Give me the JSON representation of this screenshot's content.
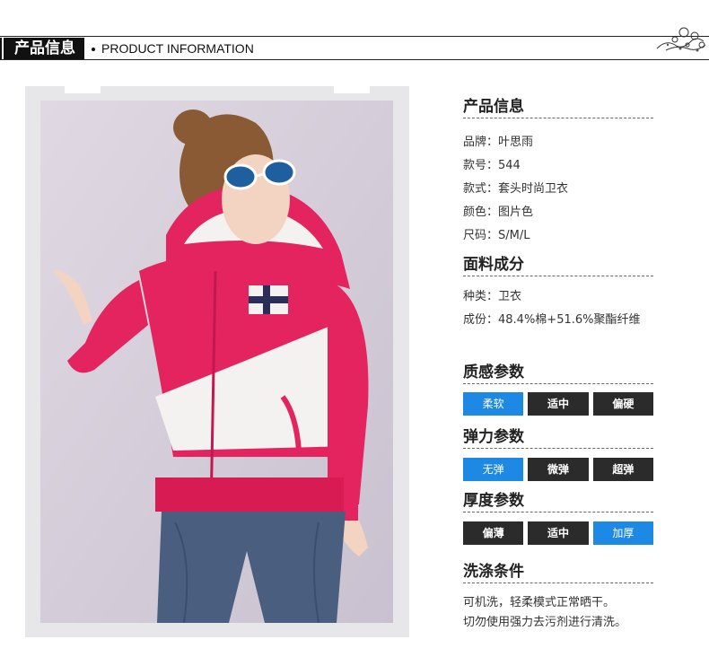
{
  "header": {
    "badge": "产品信息",
    "subtitle": "PRODUCT INFORMATION"
  },
  "photo": {
    "subject": "model-in-hoodie",
    "colors": {
      "hoodie": "#e3245f",
      "panel": "#f4f2f1",
      "jeans": "#4a5f7f",
      "background": "#d4ccd8"
    }
  },
  "product_info": {
    "title": "产品信息",
    "brand": "品牌：叶思雨",
    "style_no": "款号：544",
    "style": "款式：套头时尚卫衣",
    "color": "颜色：图片色",
    "size": "尺码：S/M/L"
  },
  "fabric": {
    "title": "面料成分",
    "type": "种类：卫衣",
    "composition": "成份：48.4%棉+51.6%聚酯纤维"
  },
  "texture": {
    "title": "质感参数",
    "options": [
      "柔软",
      "适中",
      "偏硬"
    ],
    "selected": 0
  },
  "elasticity": {
    "title": "弹力参数",
    "options": [
      "无弹",
      "微弹",
      "超弹"
    ],
    "selected": 0
  },
  "thickness": {
    "title": "厚度参数",
    "options": [
      "偏薄",
      "适中",
      "加厚"
    ],
    "selected": 2
  },
  "washing": {
    "title": "洗涤条件",
    "line1": "可机洗，轻柔模式正常晒干。",
    "line2": "切勿使用强力去污剂进行清洗。"
  },
  "accent_color": "#1e88e5",
  "button_color": "#2b2b2b"
}
